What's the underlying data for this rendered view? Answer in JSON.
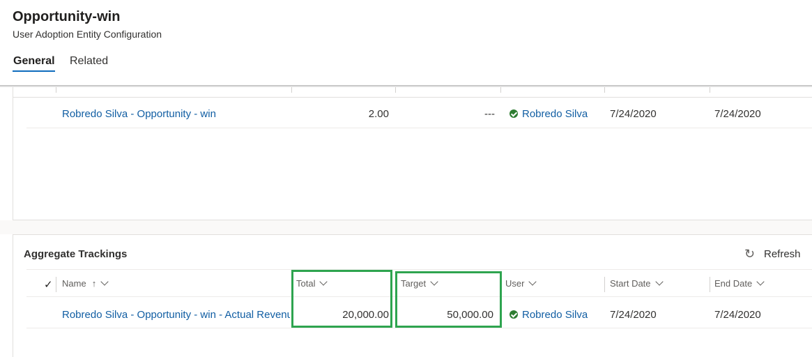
{
  "header": {
    "title": "Opportunity-win",
    "subtitle": "User Adoption Entity Configuration",
    "tabs": [
      {
        "label": "General",
        "selected": true
      },
      {
        "label": "Related",
        "selected": false
      }
    ]
  },
  "top_grid": {
    "rows": [
      {
        "name": "Robredo Silva - Opportunity - win",
        "value": "2.00",
        "target": "---",
        "user": "Robredo Silva",
        "start_date": "7/24/2020",
        "end_date": "7/24/2020"
      }
    ]
  },
  "aggregate": {
    "title": "Aggregate Trackings",
    "refresh_label": "Refresh",
    "columns": {
      "select": "✓",
      "name": "Name",
      "sort_arrow": "↑",
      "total": "Total",
      "target": "Target",
      "user": "User",
      "start_date": "Start Date",
      "end_date": "End Date"
    },
    "rows": [
      {
        "name": "Robredo Silva - Opportunity - win - Actual Revenu",
        "total": "20,000.00",
        "target": "50,000.00",
        "user": "Robredo Silva",
        "start_date": "7/24/2020",
        "end_date": "7/24/2020"
      }
    ]
  },
  "colors": {
    "link": "#115ea3",
    "highlight": "#2ea44f",
    "status_ok": "#2e7d32",
    "accent": "#0f6cbd"
  },
  "icons": {
    "status": "check-circle-icon",
    "refresh": "refresh-icon",
    "sort": "arrow-up-icon",
    "filter": "chevron-down-icon"
  }
}
